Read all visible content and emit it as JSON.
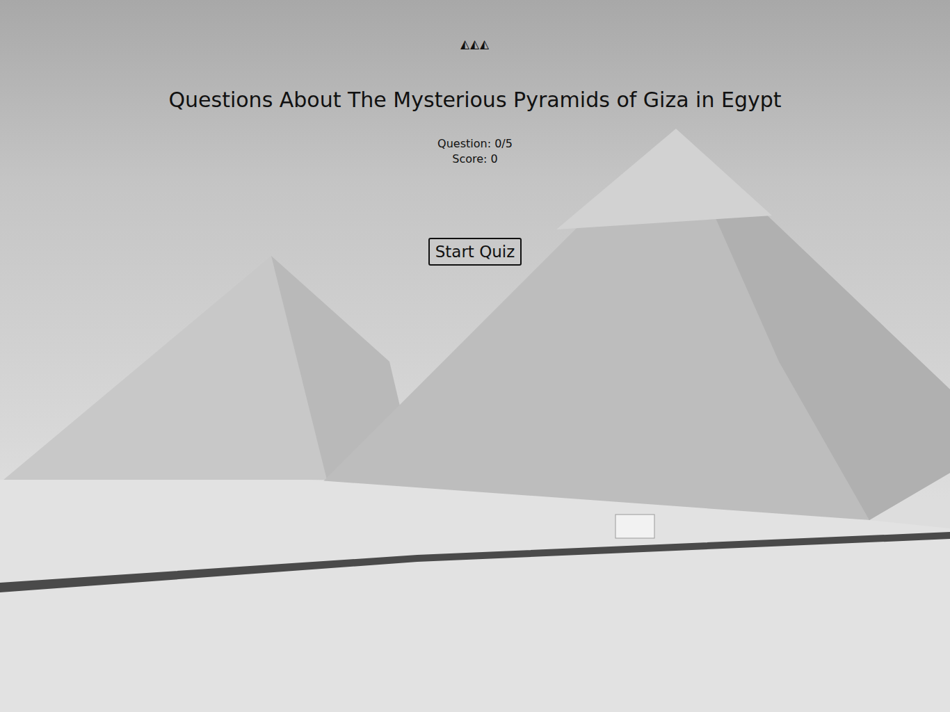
{
  "header": {
    "logo": "◭◭◭",
    "title": "Questions About The Mysterious Pyramids of Giza in Egypt"
  },
  "progress": {
    "question": "Question: 0/5",
    "score": "Score: 0"
  },
  "buttons": [
    {
      "label": "Start Quiz"
    }
  ]
}
